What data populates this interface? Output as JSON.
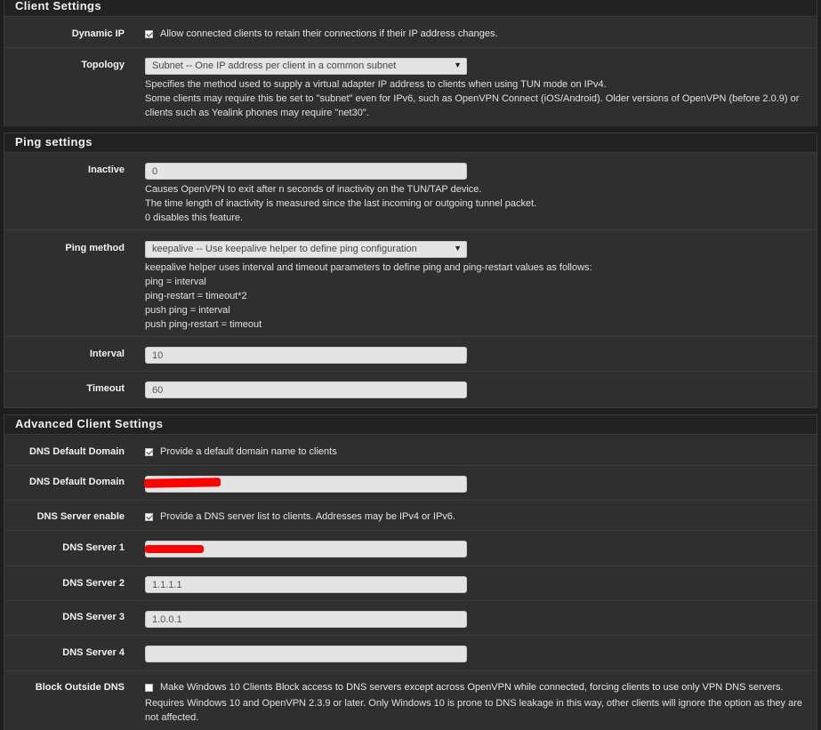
{
  "client_settings": {
    "title": "Client Settings",
    "dynamic_ip": {
      "label": "Dynamic IP",
      "checked": true,
      "text": "Allow connected clients to retain their connections if their IP address changes."
    },
    "topology": {
      "label": "Topology",
      "value": "Subnet -- One IP address per client in a common subnet",
      "help1": "Specifies the method used to supply a virtual adapter IP address to clients when using TUN mode on IPv4.",
      "help2": "Some clients may require this be set to \"subnet\" even for IPv6, such as OpenVPN Connect (iOS/Android). Older versions of OpenVPN (before 2.0.9) or",
      "help3": "clients such as Yealink phones may require \"net30\"."
    }
  },
  "ping_settings": {
    "title": "Ping settings",
    "inactive": {
      "label": "Inactive",
      "value": "0",
      "help1": "Causes OpenVPN to exit after n seconds of inactivity on the TUN/TAP device.",
      "help2": "The time length of inactivity is measured since the last incoming or outgoing tunnel packet.",
      "help3": "0 disables this feature."
    },
    "ping_method": {
      "label": "Ping method",
      "value": "keepalive -- Use keepalive helper to define ping configuration",
      "help1": "keepalive helper uses interval and timeout parameters to define ping and ping-restart values as follows:",
      "help2": "ping = interval",
      "help3": "ping-restart = timeout*2",
      "help4": "push ping = interval",
      "help5": "push ping-restart = timeout"
    },
    "interval": {
      "label": "Interval",
      "value": "10"
    },
    "timeout": {
      "label": "Timeout",
      "value": "60"
    }
  },
  "advanced": {
    "title": "Advanced Client Settings",
    "dns_default_domain_enable": {
      "label": "DNS Default Domain",
      "checked": true,
      "text": "Provide a default domain name to clients"
    },
    "dns_default_domain": {
      "label": "DNS Default Domain",
      "value": ""
    },
    "dns_server_enable": {
      "label": "DNS Server enable",
      "checked": true,
      "text": "Provide a DNS server list to clients. Addresses may be IPv4 or IPv6."
    },
    "dns_server_1": {
      "label": "DNS Server 1",
      "value": ""
    },
    "dns_server_2": {
      "label": "DNS Server 2",
      "value": "1.1.1.1"
    },
    "dns_server_3": {
      "label": "DNS Server 3",
      "value": "1.0.0.1"
    },
    "dns_server_4": {
      "label": "DNS Server 4",
      "value": ""
    },
    "block_outside_dns": {
      "label": "Block Outside DNS",
      "checked": false,
      "text": "Make Windows 10 Clients Block access to DNS servers except across OpenVPN while connected, forcing clients to use only VPN DNS servers.",
      "help1": "Requires Windows 10 and OpenVPN 2.3.9 or later. Only Windows 10 is prone to DNS leakage in this way, other clients will ignore the option as they are",
      "help2": "not affected."
    }
  },
  "colors": {
    "background": "#1e1e1e",
    "panel": "#2f2f2f",
    "header": "#222222",
    "redaction": "#ff0000"
  }
}
